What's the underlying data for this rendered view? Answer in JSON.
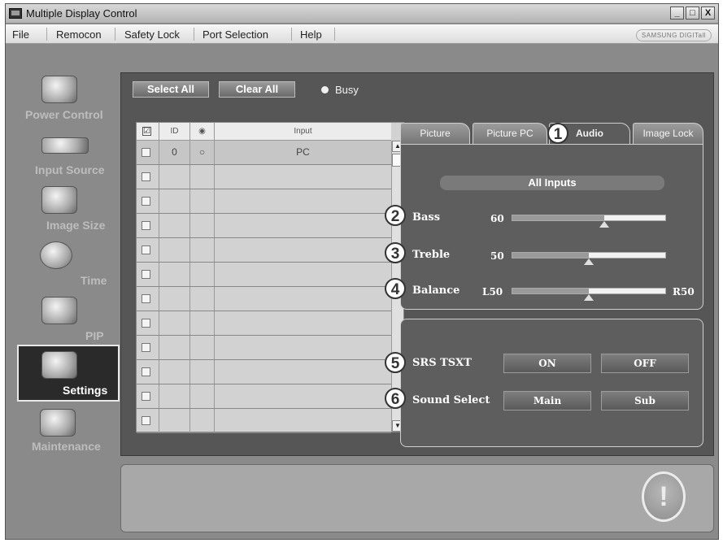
{
  "window": {
    "title": "Multiple Display Control",
    "controls": [
      "_",
      "□",
      "X"
    ]
  },
  "menu": {
    "items": [
      "File",
      "Remocon",
      "Safety Lock",
      "Port Selection",
      "Help"
    ],
    "brand": "SAMSUNG DIGITall"
  },
  "sidebar": {
    "items": [
      {
        "label": "Power Control",
        "icon": "power-icon"
      },
      {
        "label": "Input Source",
        "icon": "input-source-icon"
      },
      {
        "label": "Image Size",
        "icon": "image-size-icon"
      },
      {
        "label": "Time",
        "icon": "clock-icon"
      },
      {
        "label": "PIP",
        "icon": "pip-icon"
      },
      {
        "label": "Settings",
        "icon": "settings-icon"
      },
      {
        "label": "Maintenance",
        "icon": "maintenance-icon"
      }
    ],
    "active": "Settings"
  },
  "toolbar": {
    "select_all": "Select All",
    "clear_all": "Clear All",
    "busy": "Busy"
  },
  "grid": {
    "headers": [
      "☑",
      "ID",
      "◉",
      "Input"
    ],
    "rows": [
      {
        "id": "0",
        "status": "○",
        "input": "PC"
      },
      {
        "id": "",
        "status": "",
        "input": ""
      },
      {
        "id": "",
        "status": "",
        "input": ""
      },
      {
        "id": "",
        "status": "",
        "input": ""
      },
      {
        "id": "",
        "status": "",
        "input": ""
      },
      {
        "id": "",
        "status": "",
        "input": ""
      },
      {
        "id": "",
        "status": "",
        "input": ""
      },
      {
        "id": "",
        "status": "",
        "input": ""
      },
      {
        "id": "",
        "status": "",
        "input": ""
      },
      {
        "id": "",
        "status": "",
        "input": ""
      },
      {
        "id": "",
        "status": "",
        "input": ""
      },
      {
        "id": "",
        "status": "",
        "input": ""
      }
    ],
    "scroll_up": "▲",
    "scroll_down": "▼"
  },
  "tabs": [
    "Picture",
    "Picture PC",
    "Audio",
    "Image Lock"
  ],
  "active_tab": "Audio",
  "audio": {
    "header": "All Inputs",
    "bass": {
      "label": "Bass",
      "value": "60",
      "level": 0.6
    },
    "treble": {
      "label": "Treble",
      "value": "50",
      "level": 0.5
    },
    "balance": {
      "label": "Balance",
      "left": "L50",
      "right": "R50",
      "level": 0.5
    }
  },
  "srs": {
    "label": "SRS TSXT",
    "on": "ON",
    "off": "OFF"
  },
  "sound_select": {
    "label": "Sound Select",
    "main": "Main",
    "sub": "Sub"
  },
  "callouts": [
    "1",
    "2",
    "3",
    "4",
    "5",
    "6"
  ],
  "message_icon": "!"
}
